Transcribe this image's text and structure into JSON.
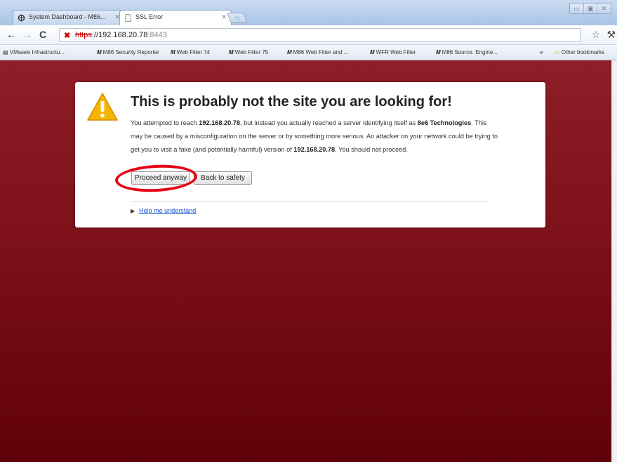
{
  "browser": {
    "tabs": [
      {
        "title": "System Dashboard - M86...",
        "active": false
      },
      {
        "title": "SSL Error",
        "active": true
      }
    ],
    "url": {
      "scheme": "https",
      "host": "://192.168.20.78",
      "port": ":8443"
    },
    "bookmarks": [
      {
        "label": "VMware Infrastructu...",
        "icon": "page-icon"
      },
      {
        "label": "M86 Security Reporter",
        "icon": "m86-logo-icon"
      },
      {
        "label": "Web Filter 74",
        "icon": "m86-logo-icon"
      },
      {
        "label": "Web Filter 75",
        "icon": "m86-logo-icon"
      },
      {
        "label": "M86 Web Filter and ...",
        "icon": "m86-logo-icon"
      },
      {
        "label": "WFR Web Filter",
        "icon": "m86-logo-icon"
      },
      {
        "label": "M86 Source. Engine...",
        "icon": "m86-logo-icon"
      }
    ],
    "other_bookmarks": "Other bookmarks",
    "overflow_chevron": "»",
    "logo_mark": "M"
  },
  "error_page": {
    "title": "This is probably not the site you are looking for!",
    "description": {
      "p1": "You attempted to reach ",
      "host": "192.168.20.78",
      "p2": ", but instead you actually reached a server identifying itself as ",
      "server": "8e6 Technologies",
      "p3": ". This may be caused by a misconfiguration on the server or by something more serious. An attacker on your network could be trying to get you to visit a fake (and potentially harmful) version of ",
      "host2": "192.168.20.78",
      "p4": ". You should not proceed."
    },
    "proceed_label": "Proceed anyway",
    "back_label": "Back to safety",
    "help_label": "Help me understand"
  },
  "colors": {
    "page_background": "#7d1019",
    "highlight_ring": "#e60012",
    "link": "#1155cc",
    "warning": "#f5b400"
  }
}
